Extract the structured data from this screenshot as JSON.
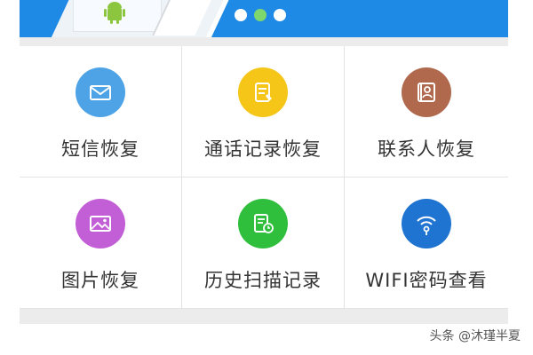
{
  "banner": {
    "carousel_dots": 3,
    "active_dot": 1,
    "accent": "#1f8ae6"
  },
  "grid": {
    "items": [
      {
        "label": "短信恢复",
        "icon": "envelope-icon",
        "color": "#4ea3e6"
      },
      {
        "label": "通话记录恢复",
        "icon": "call-log-icon",
        "color": "#f5c518"
      },
      {
        "label": "联系人恢复",
        "icon": "contact-card-icon",
        "color": "#b0694d"
      },
      {
        "label": "图片恢复",
        "icon": "picture-icon",
        "color": "#c25fd6"
      },
      {
        "label": "历史扫描记录",
        "icon": "history-scan-icon",
        "color": "#2fbf3c"
      },
      {
        "label": "WIFI密码查看",
        "icon": "wifi-key-icon",
        "color": "#1e74d0"
      }
    ]
  },
  "watermark": {
    "text": "头条 @沐瑾半夏"
  }
}
